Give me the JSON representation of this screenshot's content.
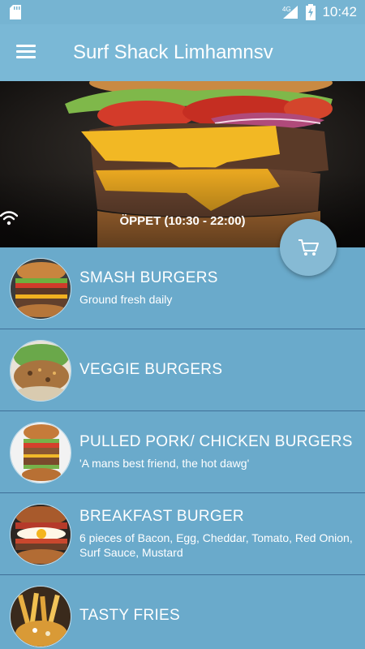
{
  "status_bar": {
    "time": "10:42",
    "network": "4G"
  },
  "app_bar": {
    "title": "Surf Shack Limhamnsv"
  },
  "hero": {
    "open_status": "ÖPPET (10:30 - 22:00)"
  },
  "categories": [
    {
      "title": "SMASH BURGERS",
      "subtitle": "Ground fresh daily"
    },
    {
      "title": "VEGGIE BURGERS",
      "subtitle": ""
    },
    {
      "title": "PULLED PORK/ CHICKEN BURGERS",
      "subtitle": "'A mans best friend, the hot dawg'"
    },
    {
      "title": "BREAKFAST BURGER",
      "subtitle": "6 pieces of Bacon, Egg, Cheddar, Tomato, Red Onion, Surf Sauce, Mustard"
    },
    {
      "title": "TASTY FRIES",
      "subtitle": ""
    }
  ]
}
